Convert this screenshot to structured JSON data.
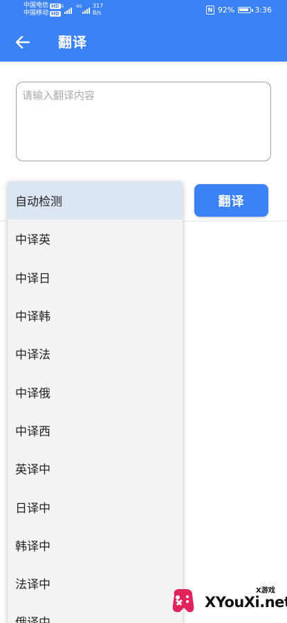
{
  "status_bar": {
    "carrier1": "中国电信",
    "carrier2": "中国移动",
    "hd_badge": "HD",
    "sim1_tag": "4G",
    "sim2_tag": "4G",
    "net_speed_value": "317",
    "net_speed_unit": "B/s",
    "battery_percent": "92%",
    "battery_level": 0.92,
    "time": "3:36"
  },
  "appbar": {
    "title": "翻译",
    "back_icon": "arrow-left-icon",
    "background_color": "#3b82f6"
  },
  "input": {
    "value": "",
    "placeholder": "请输入翻译内容"
  },
  "translate_button": {
    "label": "翻译"
  },
  "dropdown": {
    "selected_index": 0,
    "items": [
      "自动检测",
      "中译英",
      "中译日",
      "中译韩",
      "中译法",
      "中译俄",
      "中译西",
      "英译中",
      "日译中",
      "韩译中",
      "法译中",
      "俄译中"
    ]
  },
  "watermark": {
    "small_text": "X游戏",
    "big_text": "XYouXi.net"
  }
}
